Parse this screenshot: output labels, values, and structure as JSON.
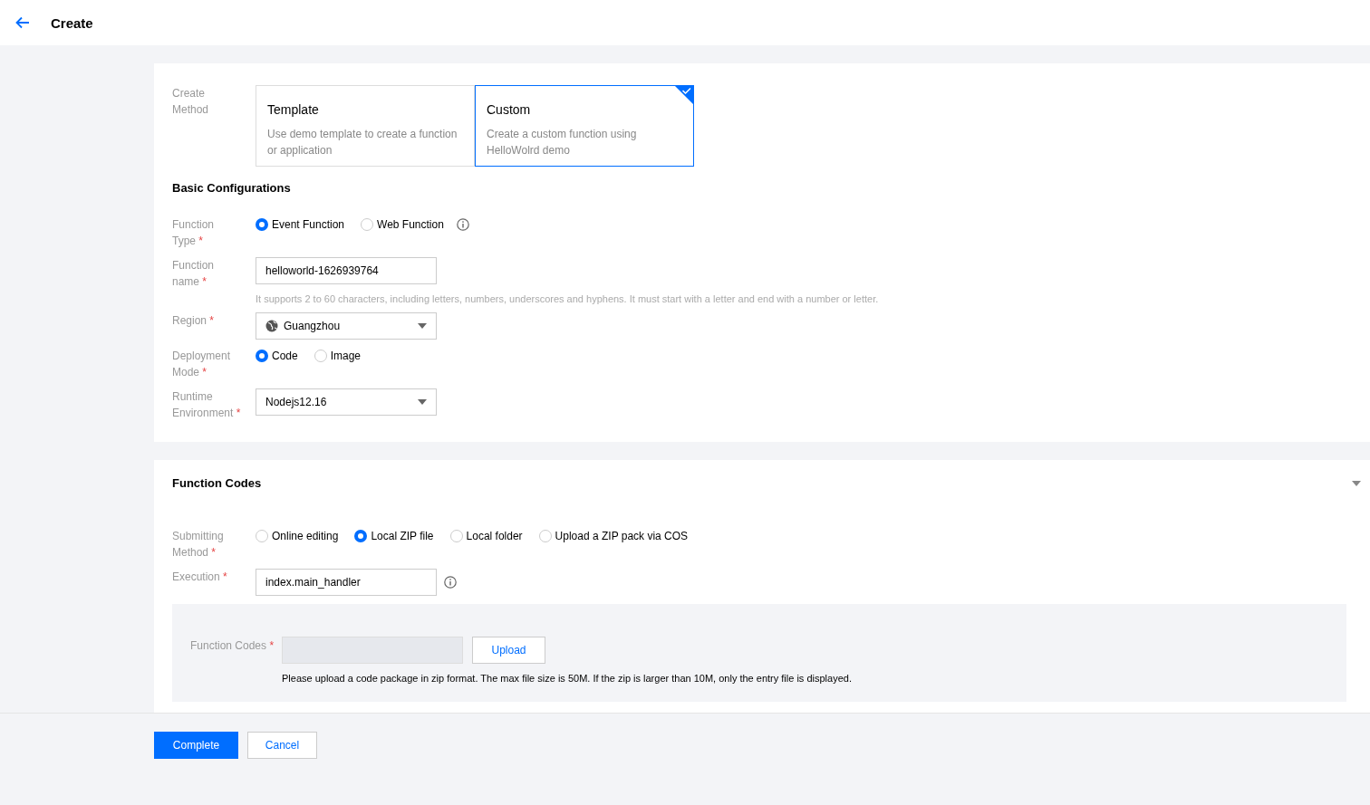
{
  "header": {
    "title": "Create"
  },
  "create_method": {
    "label": "Create Method",
    "options": [
      {
        "title": "Template",
        "description": "Use demo template to create a function or application",
        "selected": false
      },
      {
        "title": "Custom",
        "description": "Create a custom function using HelloWolrd demo",
        "selected": true
      }
    ]
  },
  "basic_configurations": {
    "title": "Basic Configurations",
    "fields": [
      {
        "kind": "radio",
        "label": "Function Type",
        "required_mark": "*",
        "info": true,
        "options": [
          {
            "label": "Event Function",
            "selected": true
          },
          {
            "label": "Web Function",
            "selected": false
          }
        ]
      },
      {
        "kind": "text",
        "label": "Function name",
        "required_mark": "*",
        "value": "helloworld-1626939764",
        "hint": "It supports 2 to 60 characters, including letters, numbers, underscores and hyphens. It must start with a letter and end with a number or letter."
      },
      {
        "kind": "region",
        "label": "Region",
        "required_mark": "*",
        "value": "Guangzhou"
      },
      {
        "kind": "radio",
        "label": "Deployment Mode",
        "required_mark": "*",
        "options": [
          {
            "label": "Code",
            "selected": true
          },
          {
            "label": "Image",
            "selected": false
          }
        ]
      },
      {
        "kind": "select",
        "label": "Runtime Environment",
        "required_mark": "*",
        "value": "Nodejs12.16"
      }
    ]
  },
  "function_codes": {
    "title": "Function Codes",
    "expanded": true,
    "fields": [
      {
        "kind": "radio",
        "label": "Submitting Method",
        "required_mark": "*",
        "options": [
          {
            "label": "Online editing",
            "selected": false
          },
          {
            "label": "Local ZIP file",
            "selected": true
          },
          {
            "label": "Local folder",
            "selected": false
          },
          {
            "label": "Upload a ZIP pack via COS",
            "selected": false
          }
        ]
      },
      {
        "kind": "text",
        "label": "Execution",
        "required_mark": "*",
        "value": "index.main_handler",
        "info": true
      }
    ],
    "upload": {
      "label": "Function Codes",
      "required_mark": "*",
      "button": "Upload",
      "note": "Please upload a code package in zip format. The max file size is 50M. If the zip is larger than 10M, only the entry file is displayed."
    }
  },
  "buttons": [
    {
      "label": "Complete",
      "kind": "primary"
    },
    {
      "label": "Cancel",
      "kind": "secondary"
    }
  ]
}
